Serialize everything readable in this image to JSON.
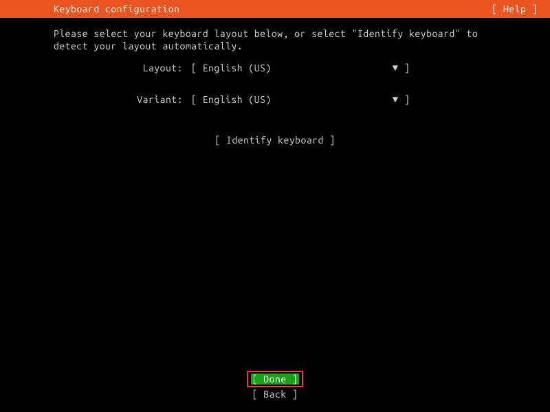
{
  "header": {
    "title": "Keyboard configuration",
    "help_label": "[ Help ]"
  },
  "instruction": "Please select your keyboard layout below, or select \"Identify keyboard\" to detect your layout automatically.",
  "form": {
    "layout": {
      "label": "Layout:",
      "value": "English (US)",
      "open": "[",
      "close": "]",
      "arrow": "▼"
    },
    "variant": {
      "label": "Variant:",
      "value": "English (US)",
      "open": "[",
      "close": "]",
      "arrow": "▼"
    }
  },
  "identify": {
    "label": "[ Identify keyboard ]"
  },
  "footer": {
    "done_open": "[ ",
    "done_label": "Done",
    "done_pad": "      ",
    "done_close": "]",
    "back_open": "[ ",
    "back_label": "Back",
    "back_pad": "      ",
    "back_close": "]"
  }
}
